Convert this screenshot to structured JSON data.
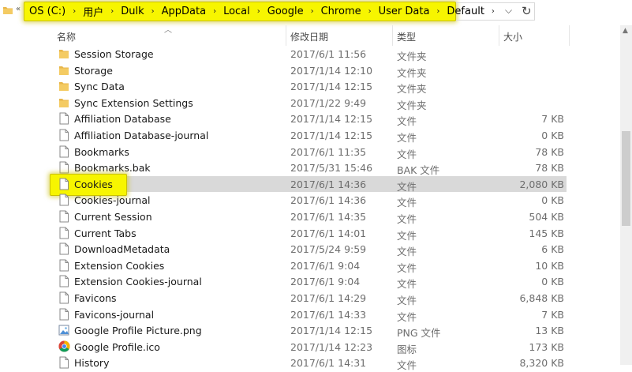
{
  "breadcrumb": [
    "OS (C:)",
    "用户",
    "Dulk",
    "AppData",
    "Local",
    "Google",
    "Chrome",
    "User Data",
    "Default"
  ],
  "address": {
    "dropdown_icon": "chevron-down-icon",
    "refresh_icon": "refresh-icon"
  },
  "columns": {
    "name": "名称",
    "date": "修改日期",
    "type": "类型",
    "size": "大小"
  },
  "colors": {
    "highlight": "#f7f500",
    "selected_row": "#d9d9d9",
    "folder": "#e8b64a"
  },
  "files": [
    {
      "name": "Session Storage",
      "date": "2017/6/1 11:56",
      "type": "文件夹",
      "size": "",
      "icon": "folder"
    },
    {
      "name": "Storage",
      "date": "2017/1/14 12:10",
      "type": "文件夹",
      "size": "",
      "icon": "folder"
    },
    {
      "name": "Sync Data",
      "date": "2017/1/14 12:15",
      "type": "文件夹",
      "size": "",
      "icon": "folder"
    },
    {
      "name": "Sync Extension Settings",
      "date": "2017/1/22 9:49",
      "type": "文件夹",
      "size": "",
      "icon": "folder"
    },
    {
      "name": "Affiliation Database",
      "date": "2017/1/14 12:15",
      "type": "文件",
      "size": "7 KB",
      "icon": "file"
    },
    {
      "name": "Affiliation Database-journal",
      "date": "2017/1/14 12:15",
      "type": "文件",
      "size": "0 KB",
      "icon": "file"
    },
    {
      "name": "Bookmarks",
      "date": "2017/6/1 11:35",
      "type": "文件",
      "size": "78 KB",
      "icon": "file"
    },
    {
      "name": "Bookmarks.bak",
      "date": "2017/5/31 15:46",
      "type": "BAK 文件",
      "size": "78 KB",
      "icon": "file"
    },
    {
      "name": "Cookies",
      "date": "2017/6/1 14:36",
      "type": "文件",
      "size": "2,080 KB",
      "icon": "file",
      "selected": true
    },
    {
      "name": "Cookies-journal",
      "date": "2017/6/1 14:36",
      "type": "文件",
      "size": "0 KB",
      "icon": "file"
    },
    {
      "name": "Current Session",
      "date": "2017/6/1 14:35",
      "type": "文件",
      "size": "504 KB",
      "icon": "file"
    },
    {
      "name": "Current Tabs",
      "date": "2017/6/1 14:01",
      "type": "文件",
      "size": "145 KB",
      "icon": "file"
    },
    {
      "name": "DownloadMetadata",
      "date": "2017/5/24 9:59",
      "type": "文件",
      "size": "6 KB",
      "icon": "file"
    },
    {
      "name": "Extension Cookies",
      "date": "2017/6/1 9:04",
      "type": "文件",
      "size": "10 KB",
      "icon": "file"
    },
    {
      "name": "Extension Cookies-journal",
      "date": "2017/6/1 9:04",
      "type": "文件",
      "size": "0 KB",
      "icon": "file"
    },
    {
      "name": "Favicons",
      "date": "2017/6/1 14:29",
      "type": "文件",
      "size": "6,848 KB",
      "icon": "file"
    },
    {
      "name": "Favicons-journal",
      "date": "2017/6/1 14:33",
      "type": "文件",
      "size": "7 KB",
      "icon": "file"
    },
    {
      "name": "Google Profile Picture.png",
      "date": "2017/1/14 12:15",
      "type": "PNG 文件",
      "size": "13 KB",
      "icon": "image"
    },
    {
      "name": "Google Profile.ico",
      "date": "2017/1/14 12:23",
      "type": "图标",
      "size": "173 KB",
      "icon": "chrome"
    },
    {
      "name": "History",
      "date": "2017/6/1 14:31",
      "type": "文件",
      "size": "8,320 KB",
      "icon": "file"
    }
  ]
}
